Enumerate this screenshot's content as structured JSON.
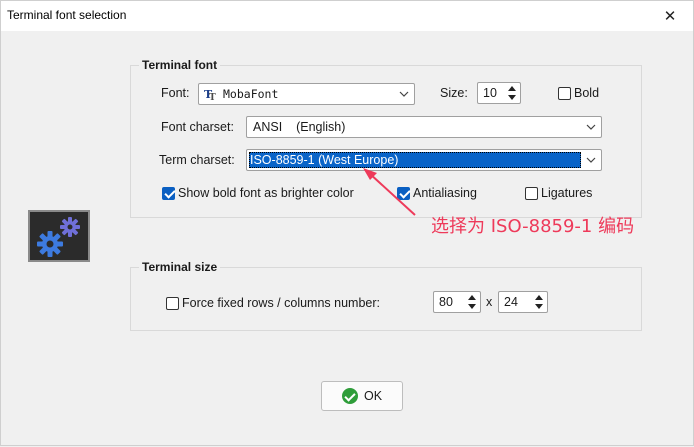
{
  "window": {
    "title": "Terminal font selection"
  },
  "terminal_font": {
    "group_title": "Terminal font",
    "font_label": "Font:",
    "font_value": "MobaFont",
    "font_icon": "truetype-font-icon",
    "size_label": "Size:",
    "size_value": "10",
    "bold_label": "Bold",
    "bold_checked": false,
    "font_charset_label": "Font charset:",
    "font_charset_value": "ANSI    (English)",
    "term_charset_label": "Term charset:",
    "term_charset_value": "ISO-8859-1 (West Europe)",
    "show_bold_label": "Show bold font as brighter color",
    "show_bold_checked": true,
    "antialiasing_label": "Antialiasing",
    "antialiasing_checked": true,
    "ligatures_label": "Ligatures",
    "ligatures_checked": false
  },
  "annotation": {
    "text": "选择为 ISO-8859-1 编码",
    "color": "#ee3a5a"
  },
  "terminal_size": {
    "group_title": "Terminal size",
    "force_label": "Force fixed rows / columns number:",
    "force_checked": false,
    "cols_value": "80",
    "separator": "x",
    "rows_value": "24"
  },
  "ok_button": {
    "label": "OK"
  },
  "colors": {
    "accent": "#0a64c8",
    "ok_icon": "#2f9d3a",
    "gear": "#3d7be0"
  }
}
